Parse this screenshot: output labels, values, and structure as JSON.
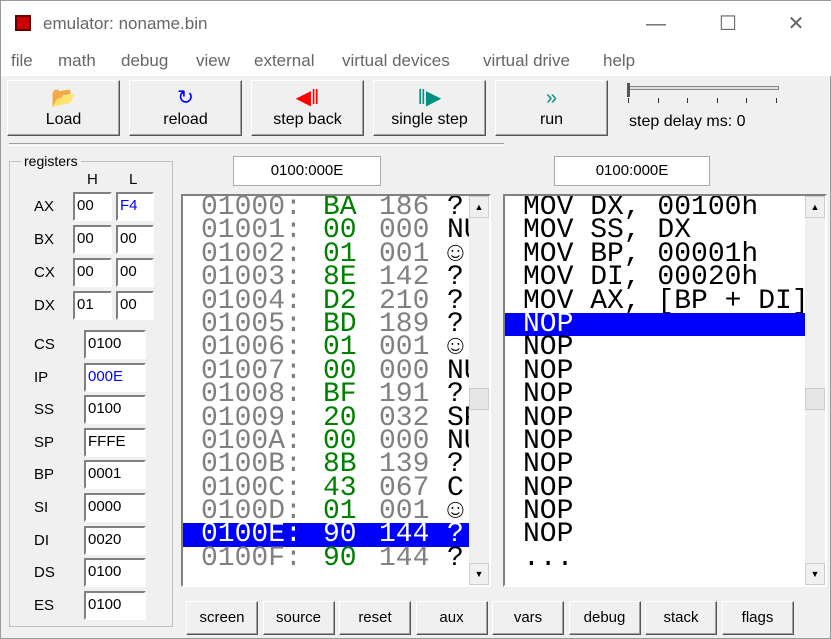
{
  "window": {
    "title": "emulator: noname.bin",
    "controls": [
      "—",
      "☐",
      "✕"
    ]
  },
  "menu": [
    "file",
    "math",
    "debug",
    "view",
    "external",
    "virtual devices",
    "virtual drive",
    "help"
  ],
  "toolbar": [
    {
      "label": "Load",
      "icon": "open-folder-icon",
      "glyph": "📂",
      "color": "#c8a000"
    },
    {
      "label": "reload",
      "icon": "reload-icon",
      "glyph": "↻",
      "color": "#0000ff"
    },
    {
      "label": "step back",
      "icon": "step-back-icon",
      "glyph": "◀‖",
      "color": "#ff0000"
    },
    {
      "label": "single step",
      "icon": "single-step-icon",
      "glyph": "‖▶",
      "color": "#009080"
    },
    {
      "label": "run",
      "icon": "run-icon",
      "glyph": "»",
      "color": "#009080"
    }
  ],
  "step_delay": {
    "label": "step delay ms: 0",
    "value": 0
  },
  "registers": {
    "title": "registers",
    "h": "H",
    "l": "L",
    "split": [
      {
        "name": "AX",
        "h": "00",
        "l": "F4"
      },
      {
        "name": "BX",
        "h": "00",
        "l": "00"
      },
      {
        "name": "CX",
        "h": "00",
        "l": "00"
      },
      {
        "name": "DX",
        "h": "01",
        "l": "00"
      }
    ],
    "full": [
      {
        "name": "CS",
        "v": "0100"
      },
      {
        "name": "IP",
        "v": "000E"
      },
      {
        "name": "SS",
        "v": "0100"
      },
      {
        "name": "SP",
        "v": "FFFE"
      },
      {
        "name": "BP",
        "v": "0001"
      },
      {
        "name": "SI",
        "v": "0000"
      },
      {
        "name": "DI",
        "v": "0020"
      },
      {
        "name": "DS",
        "v": "0100"
      },
      {
        "name": "ES",
        "v": "0100"
      }
    ]
  },
  "memory": {
    "address": "0100:000E",
    "rows": [
      [
        "01000:",
        "BA",
        "186",
        "?"
      ],
      [
        "01001:",
        "00",
        "000",
        "NU"
      ],
      [
        "01002:",
        "01",
        "001",
        "☺"
      ],
      [
        "01003:",
        "8E",
        "142",
        "?"
      ],
      [
        "01004:",
        "D2",
        "210",
        "?"
      ],
      [
        "01005:",
        "BD",
        "189",
        "?"
      ],
      [
        "01006:",
        "01",
        "001",
        "☺"
      ],
      [
        "01007:",
        "00",
        "000",
        "NU"
      ],
      [
        "01008:",
        "BF",
        "191",
        "?"
      ],
      [
        "01009:",
        "20",
        "032",
        "SP"
      ],
      [
        "0100A:",
        "00",
        "000",
        "NU"
      ],
      [
        "0100B:",
        "8B",
        "139",
        "?"
      ],
      [
        "0100C:",
        "43",
        "067",
        "C"
      ],
      [
        "0100D:",
        "01",
        "001",
        "☺"
      ],
      [
        "0100E:",
        "90",
        "144",
        "?"
      ],
      [
        "0100F:",
        "90",
        "144",
        "?"
      ]
    ],
    "selected": 14
  },
  "disasm": {
    "address": "0100:000E",
    "rows": [
      "MOV DX, 00100h",
      "MOV SS, DX",
      "MOV BP, 00001h",
      "MOV DI, 00020h",
      "MOV AX, [BP + DI]",
      "NOP",
      "NOP",
      "NOP",
      "NOP",
      "NOP",
      "NOP",
      "NOP",
      "NOP",
      "NOP",
      "NOP",
      "..."
    ],
    "selected": 5
  },
  "bottom_buttons": [
    "screen",
    "source",
    "reset",
    "aux",
    "vars",
    "debug",
    "stack",
    "flags"
  ],
  "colors": {
    "selection": "#0000ff",
    "hex": "#008000",
    "addr": "#808080",
    "changed": "#0000ff"
  }
}
